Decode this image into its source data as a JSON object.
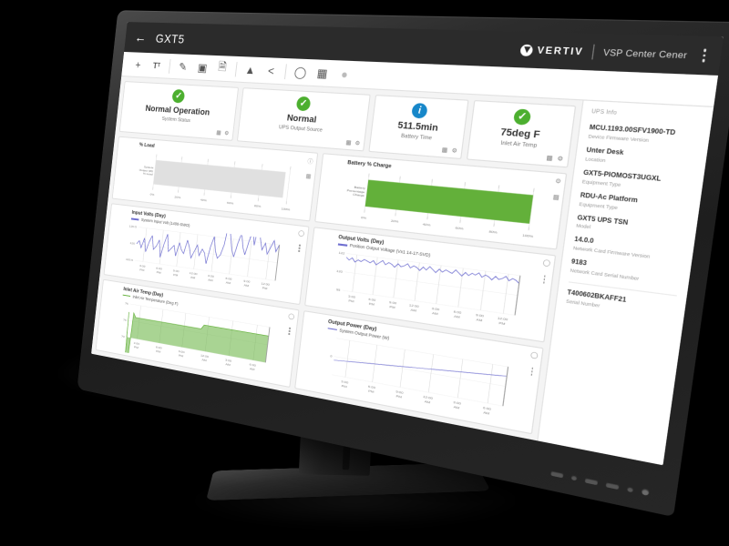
{
  "app": {
    "title": "GXT5",
    "back_icon": "back-arrow-icon",
    "brand": "VERTIV",
    "product": "VSP Center Cener",
    "menu_icon": "kebab-menu-icon"
  },
  "toolbar": {
    "items": [
      {
        "name": "add-widget-button",
        "glyph": "+"
      },
      {
        "name": "text-tool-button",
        "glyph": "Tt"
      },
      {
        "name": "edit-pencil-button",
        "glyph": "✎"
      },
      {
        "name": "image-tool-button",
        "glyph": "⛶"
      },
      {
        "name": "file-tool-button",
        "glyph": "▤"
      },
      {
        "name": "alarm-warning-button",
        "glyph": "⚠"
      },
      {
        "name": "share-button",
        "glyph": "⑂"
      },
      {
        "name": "history-clock-button",
        "glyph": "⏱"
      },
      {
        "name": "chart-tool-button",
        "glyph": "▦"
      },
      {
        "name": "shield-status-button",
        "glyph": "⛉"
      }
    ]
  },
  "cards": [
    {
      "icon": "check-circle-icon",
      "icon_type": "ok",
      "value": "Normal Operation",
      "label": "System Status"
    },
    {
      "icon": "check-circle-icon",
      "icon_type": "ok",
      "value": "Normal",
      "label": "UPS Output Source"
    },
    {
      "icon": "info-circle-icon",
      "icon_type": "info",
      "value": "511.5min",
      "label": "Battery Time"
    },
    {
      "icon": "check-circle-icon",
      "icon_type": "ok",
      "value": "75deg F",
      "label": "Inlet Air Temp"
    }
  ],
  "card_icons": {
    "chart_icon": "▥",
    "gear_icon": "⚙"
  },
  "panels": {
    "load": {
      "title": "% Load",
      "ylabel": "System Output (W) % Load",
      "tool_icon": "info-circle-icon"
    },
    "battery": {
      "title": "Battery % Charge",
      "ylabel": "Battery Percentage Charge",
      "tool_icon": "gear-icon"
    },
    "input_volts": {
      "title": "Input Volts (Day)",
      "legend": "System Input Volt (1400-SWO)",
      "tool_icon": "clock-icon"
    },
    "output_volts": {
      "title": "Output Volts (Day)",
      "legend": "Position Output Voltage (Vx1 14-17-SVD)",
      "tool_icon": "clock-icon"
    },
    "inlet_temp": {
      "title": "Inlet Air Temp (Day)",
      "legend": "Inlet Air Temperature (Deg F)",
      "tool_icon": "clock-icon"
    },
    "output_power": {
      "title": "Output Power (Day)",
      "legend": "System Output Power (W)",
      "tool_icon": "clock-icon"
    }
  },
  "info": {
    "header": "UPS Info",
    "items": [
      {
        "value": "MCU.1193.00SFV1900-TD",
        "label": "Device Firmware Version"
      },
      {
        "value": "Unter Desk",
        "label": "Location"
      },
      {
        "value": "GXT5-PIOMOST3UGXL",
        "label": "Equipment Type"
      },
      {
        "value": "RDU-Ac Platform",
        "label": "Equipment Type"
      },
      {
        "value": "GXT5 UPS TSN",
        "label": "Model"
      },
      {
        "value": "14.0.0",
        "label": "Network Card Firmware Version"
      },
      {
        "value": "9183",
        "label": "Network Card Serial Number"
      },
      {
        "value": "T400602BKAFF21",
        "label": "Serial Number"
      }
    ]
  },
  "chart_data": [
    {
      "id": "load",
      "type": "bar",
      "title": "% Load",
      "orientation": "horizontal",
      "categories": [
        "System Output (W) % Load"
      ],
      "values": [
        97
      ],
      "xlabel": "",
      "ylabel": "System Output (W) % Load",
      "tick_labels": [
        "0%",
        "20%",
        "40%",
        "60%",
        "80%",
        "100%"
      ],
      "xlim": [
        0,
        100
      ],
      "color": "#e0e0e0",
      "grid": true
    },
    {
      "id": "battery",
      "type": "bar",
      "title": "Battery % Charge",
      "orientation": "horizontal",
      "categories": [
        "Battery Percentage Charge"
      ],
      "values": [
        100
      ],
      "xlabel": "",
      "ylabel": "Battery Percentage Charge",
      "tick_labels": [
        "0%",
        "20%",
        "40%",
        "60%",
        "80%",
        "100%"
      ],
      "xlim": [
        0,
        100
      ],
      "color": "#63b03a",
      "grid": true
    },
    {
      "id": "input_volts",
      "type": "line",
      "title": "Input Volts (Day)",
      "series": [
        {
          "name": "System Input Volt (1400-SWO)",
          "values": [
            120.0,
            120.1,
            119.9,
            120.2,
            119.8,
            120.1,
            120.3,
            119.9,
            120.0,
            120.2,
            119.7,
            120.1,
            120.4,
            119.9,
            120.0,
            120.1,
            119.8,
            120.2,
            120.0,
            119.9,
            120.3,
            120.1,
            119.8,
            120.0,
            120.2,
            119.9,
            120.1,
            120.0,
            119.7,
            120.2,
            120.5,
            120.1,
            119.9,
            120.0,
            120.3,
            121.0,
            120.6,
            120.2,
            120.0,
            120.4,
            120.7,
            120.3,
            120.1,
            120.5,
            120.8,
            120.4,
            121.2,
            120.6,
            120.3,
            120.5,
            120.2,
            120.4,
            120.6,
            120.3,
            120.5
          ]
        }
      ],
      "ylabel": "",
      "ylim": [
        119.5,
        120.5
      ],
      "ytick_labels": [
        "120.5",
        "120",
        "119.5"
      ],
      "xtick_labels": [
        "3:00 PM",
        "6:00 PM",
        "9:00 PM",
        "12:00 AM",
        "3:00 AM",
        "6:00 AM",
        "9:00 AM",
        "12:00 PM"
      ],
      "color": "#6f6fd0",
      "grid": true
    },
    {
      "id": "output_volts",
      "type": "line",
      "title": "Output Volts (Day)",
      "series": [
        {
          "name": "Position Output Voltage (Vx1 14-17-SVD)",
          "values": [
            122,
            120,
            122,
            119,
            121,
            120,
            122,
            121,
            120,
            122,
            119,
            121,
            123,
            120,
            122,
            121,
            119,
            122,
            120,
            121,
            123,
            120,
            122,
            121,
            119,
            122,
            120,
            123,
            121,
            119,
            122,
            120,
            122,
            121,
            120,
            123,
            121,
            119,
            122,
            120,
            122,
            121,
            123,
            120,
            122,
            121,
            119,
            122,
            120,
            121,
            123,
            120,
            122,
            121,
            119
          ]
        }
      ],
      "ylabel": "",
      "ylim": [
        95,
        125
      ],
      "ytick_labels": [
        "122",
        "120",
        "95"
      ],
      "xtick_labels": [
        "3:00 PM",
        "6:00 PM",
        "9:00 PM",
        "12:00 AM",
        "3:00 AM",
        "6:00 AM",
        "9:00 AM",
        "12:00 PM"
      ],
      "color": "#6f6fd0",
      "grid": true
    },
    {
      "id": "inlet_temp",
      "type": "area",
      "title": "Inlet Air Temp (Day)",
      "series": [
        {
          "name": "Inlet Air Temperature (Deg F)",
          "values": [
            76,
            50,
            76,
            75,
            75,
            75,
            75,
            75,
            75,
            75,
            75,
            75,
            75,
            75,
            75,
            75,
            75,
            75,
            75,
            75,
            75,
            75,
            75,
            75,
            75,
            75,
            75,
            75,
            75,
            75,
            76,
            76,
            76,
            76,
            76,
            76,
            76,
            76,
            76,
            76,
            76,
            76,
            76,
            76,
            76,
            76,
            76,
            76,
            76,
            76,
            76,
            76,
            76,
            76,
            76
          ]
        }
      ],
      "ylabel": "",
      "ylim": [
        70,
        78
      ],
      "ytick_labels": [
        "76",
        "75",
        "70"
      ],
      "xtick_labels": [
        "3:00 PM",
        "6:00 PM",
        "9:00 PM",
        "12:00 AM",
        "3:00 AM",
        "6:00 AM"
      ],
      "color": "#63b03a",
      "grid": true
    },
    {
      "id": "output_power",
      "type": "line",
      "title": "Output Power (Day)",
      "series": [
        {
          "name": "System Output Power (W)",
          "values": [
            60,
            61,
            62,
            63,
            64,
            65,
            66,
            67,
            68,
            69,
            70,
            71,
            72,
            73,
            74,
            75,
            76,
            77,
            78,
            79,
            80,
            81,
            82,
            83,
            84,
            85,
            86,
            87,
            88,
            89,
            90,
            91,
            92,
            93,
            94,
            95,
            96,
            97,
            98,
            99,
            100,
            101,
            102,
            103,
            104,
            105,
            106,
            107,
            108,
            109,
            110,
            111,
            112,
            113,
            114
          ]
        }
      ],
      "ylabel": "",
      "ylim": [
        0,
        150
      ],
      "ytick_labels": [
        "",
        "0",
        ""
      ],
      "xtick_labels": [
        "3:00 PM",
        "6:00 PM",
        "9:00 PM",
        "12:00 AM",
        "3:00 AM",
        "6:00 AM"
      ],
      "color": "#6f6fd0",
      "grid": true
    }
  ]
}
